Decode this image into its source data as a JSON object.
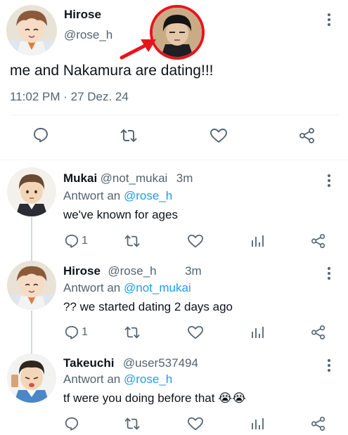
{
  "main_tweet": {
    "name": "Hirose",
    "handle": "@rose_h",
    "text": "me and Nakamura are dating!!!",
    "timestamp": "11:02 PM · 27 Dez. 24"
  },
  "replies": [
    {
      "name": "Mukai",
      "handle": "@not_mukai",
      "time": "3m",
      "reply_prefix": "Antwort an",
      "reply_to": "@rose_h",
      "text": "we've known for ages",
      "reply_count": "1"
    },
    {
      "name": "Hirose",
      "handle": "@rose_h",
      "time": "3m",
      "reply_prefix": "Antwort an",
      "reply_to": "@not_mukai",
      "text": "?? we started dating 2 days ago",
      "reply_count": "1"
    },
    {
      "name": "Takeuchi",
      "handle": "@user537494",
      "reply_prefix": "Antwort an",
      "reply_to": "@rose_h",
      "text": "tf were you doing before that",
      "emoji": "😭😭"
    }
  ],
  "icons": {
    "reply": "speech-bubble-icon",
    "retweet": "retweet-icon",
    "like": "heart-icon",
    "share": "share-icon",
    "stats": "bar-chart-icon",
    "more": "vertical-dots-icon",
    "annotation": "red-arrow-icon"
  },
  "colors": {
    "link": "#1d9bf0",
    "secondary_text": "#536471",
    "annotation_red": "#e8141b",
    "divider": "#eff3f4"
  }
}
